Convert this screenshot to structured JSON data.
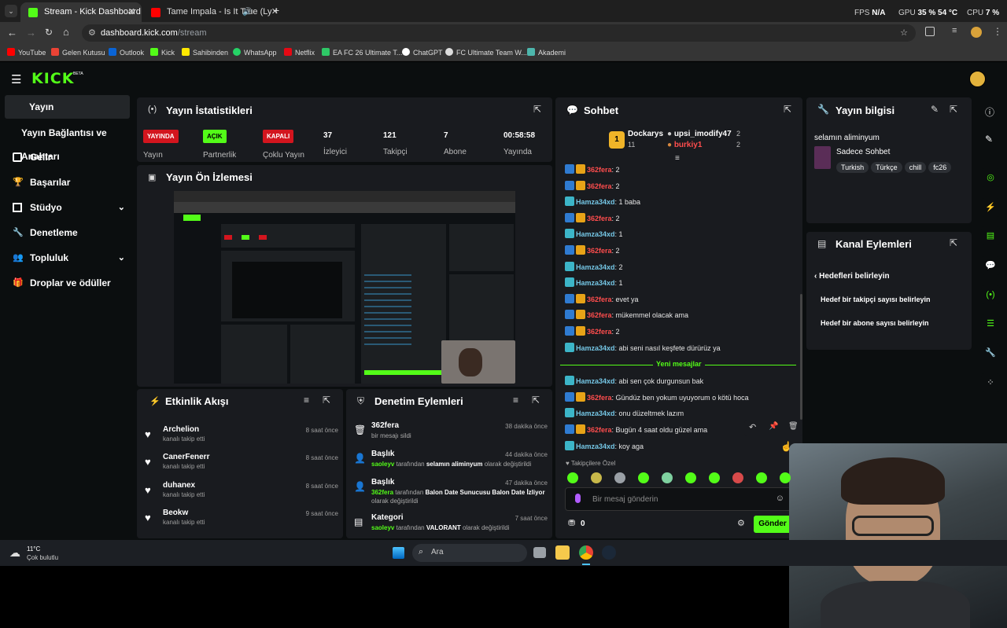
{
  "browser": {
    "tabs": [
      {
        "label": "Stream - Kick Dashboard",
        "active": true
      },
      {
        "label": "Tame Impala - Is It True (Ly",
        "active": false
      }
    ],
    "url_host": "dashboard.kick.com",
    "url_path": "/stream",
    "hud": {
      "fps_label": "FPS",
      "fps_value": "N/A",
      "gpu_label": "GPU",
      "gpu_value": "35 % 54 °C",
      "cpu_label": "CPU",
      "cpu_value": "7 %"
    },
    "bookmarks": [
      "YouTube",
      "Gelen Kutusu",
      "Outlook",
      "Kick",
      "Sahibinden",
      "WhatsApp",
      "Netflix",
      "EA FC 26 Ultimate T...",
      "ChatGPT",
      "FC Ultimate Team W...",
      "Akademi"
    ]
  },
  "app": {
    "logo": "KICK",
    "logo_beta": "BETA",
    "sidebar": [
      {
        "label": "Yayın",
        "active": true
      },
      {
        "label": "Yayın Bağlantısı ve Anahtarı"
      },
      {
        "label": "Gelir"
      },
      {
        "label": "Başarılar"
      },
      {
        "label": "Stüdyo"
      },
      {
        "label": "Denetleme"
      },
      {
        "label": "Topluluk"
      },
      {
        "label": "Droplar ve ödüller"
      }
    ]
  },
  "stats": {
    "title": "Yayın İstatistikleri",
    "items": [
      {
        "badge": "YAYINDA",
        "label": "Yayın"
      },
      {
        "badge": "AÇIK",
        "label": "Partnerlik"
      },
      {
        "badge": "KAPALI",
        "label": "Çoklu Yayın"
      },
      {
        "value": "37",
        "label": "İzleyici"
      },
      {
        "value": "121",
        "label": "Takipçi"
      },
      {
        "value": "7",
        "label": "Abone"
      },
      {
        "value": "00:58:58",
        "label": "Yayında"
      }
    ]
  },
  "preview": {
    "title": "Yayın Ön İzlemesi"
  },
  "activity": {
    "title": "Etkinlik Akışı",
    "items": [
      {
        "name": "Archelion",
        "sub": "kanalı takip etti",
        "time": "8 saat önce"
      },
      {
        "name": "CanerFenerr",
        "sub": "kanalı takip etti",
        "time": "8 saat önce"
      },
      {
        "name": "duhanex",
        "sub": "kanalı takip etti",
        "time": "8 saat önce"
      },
      {
        "name": "Beokw",
        "sub": "kanalı takip etti",
        "time": "9 saat önce"
      }
    ]
  },
  "moderation": {
    "title": "Denetim Eylemleri",
    "items": [
      {
        "name": "362fera",
        "sub": "bir mesajı sildi",
        "time": "38 dakika önce"
      },
      {
        "name": "Başlık",
        "actor": "saoleyv",
        "mid": "tarafından",
        "value": "selamın aliminyum",
        "suffix": "olarak değiştirildi",
        "time": "44 dakika önce"
      },
      {
        "name": "Başlık",
        "actor": "362fera",
        "mid": "tarafından",
        "value": "Balon Date Sunucusu Balon Date İzliyor",
        "suffix": "olarak değiştirildi",
        "time": "47 dakika önce"
      },
      {
        "name": "Kategori",
        "actor": "saoleyv",
        "mid": "tarafından",
        "value": "VALORANT",
        "suffix": "olarak değiştirildi",
        "time": "7 saat önce"
      }
    ]
  },
  "chat": {
    "title": "Sohbet",
    "leaderboard": [
      {
        "rank": "1",
        "name": "Dockarys",
        "count": "11"
      },
      {
        "name": "upsi_imodify47",
        "count": "2"
      },
      {
        "name": "burkiy1",
        "count": "2"
      }
    ],
    "messages": [
      {
        "user": "362fera",
        "text": ": 2",
        "kind": "u1"
      },
      {
        "user": "362fera",
        "text": ": 2",
        "kind": "u1"
      },
      {
        "user": "Hamza34xd",
        "text": ": 1 baba",
        "kind": "u2"
      },
      {
        "user": "362fera",
        "text": ": 2",
        "kind": "u1"
      },
      {
        "user": "Hamza34xd",
        "text": ": 1",
        "kind": "u2"
      },
      {
        "user": "362fera",
        "text": ": 2",
        "kind": "u1"
      },
      {
        "user": "Hamza34xd",
        "text": ": 2",
        "kind": "u2"
      },
      {
        "user": "Hamza34xd",
        "text": ": 1",
        "kind": "u2"
      },
      {
        "user": "362fera",
        "text": ": evet ya",
        "kind": "u1"
      },
      {
        "user": "362fera",
        "text": ": mükemmel olacak ama",
        "kind": "u1"
      },
      {
        "user": "362fera",
        "text": ": 2",
        "kind": "u1"
      },
      {
        "user": "Hamza34xd",
        "text": ": abi seni nasıl keşfete dürürüz ya",
        "kind": "u2"
      }
    ],
    "new_label": "Yeni mesajlar",
    "new_messages": [
      {
        "user": "Hamza34xd",
        "text": ": abi sen çok durgunsun bak",
        "kind": "u2"
      },
      {
        "user": "362fera",
        "text": ": Gündüz ben yokum uyuyorum o kötü hoca",
        "kind": "u1"
      },
      {
        "user": "Hamza34xd",
        "text": ": onu düzeltmek lazım",
        "kind": "u2"
      },
      {
        "user": "362fera",
        "text": ": Bugün 4 saat oldu güzel ama",
        "kind": "u1"
      },
      {
        "user": "Hamza34xd",
        "text": ": koy aga",
        "kind": "u2"
      }
    ],
    "followers_only": "Takipçilere Özel",
    "input_placeholder": "Bir mesaj gönderin",
    "points": "0",
    "send_label": "Gönder"
  },
  "stream_info": {
    "title": "Yayın bilgisi",
    "stream_title": "selamın aliminyum",
    "category": "Sadece Sohbet",
    "tags": [
      "Turkish",
      "Türkçe",
      "chill",
      "fc26"
    ]
  },
  "channel_actions": {
    "title": "Kanal Eylemleri",
    "back_label": "Hedefleri belirleyin",
    "items": [
      "Hedef bir takipçi sayısı belirleyin",
      "Hedef bir abone sayısı belirleyin"
    ]
  },
  "taskbar": {
    "weather_temp": "11°C",
    "weather_desc": "Çok bulutlu",
    "search": "Ara"
  },
  "colors": {
    "accent": "#53fc18",
    "live_red": "#d3151e",
    "panel": "#191b1f",
    "bg": "#0b0e0f"
  }
}
